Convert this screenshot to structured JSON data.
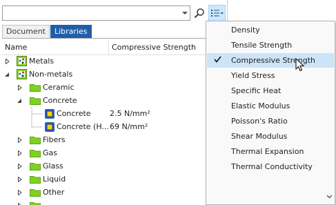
{
  "search": {
    "value": "",
    "placeholder": ""
  },
  "tabs": [
    {
      "label": "Document",
      "active": false
    },
    {
      "label": "Libraries",
      "active": true
    }
  ],
  "columns": {
    "name": "Name",
    "strength": "Compressive Strength"
  },
  "tree": {
    "metals": "Metals",
    "nonmetals": "Non-metals",
    "ceramic": "Ceramic",
    "concrete": "Concrete",
    "concrete_1": {
      "name": "Concrete",
      "value": "2.5 N/mm²"
    },
    "concrete_2": {
      "name": "Concrete (H...",
      "value": "69 N/mm²"
    },
    "fibers": "Fibers",
    "gas": "Gas",
    "glass": "Glass",
    "liquid": "Liquid",
    "other": "Other"
  },
  "menu": {
    "items": [
      {
        "label": "Density"
      },
      {
        "label": "Tensile Strength"
      },
      {
        "label": "Compressive Strength",
        "checked": true
      },
      {
        "label": "Yield Stress"
      },
      {
        "label": "Specific Heat"
      },
      {
        "label": "Elastic Modulus"
      },
      {
        "label": "Poisson's Ratio"
      },
      {
        "label": "Shear Modulus"
      },
      {
        "label": "Thermal Expansion"
      },
      {
        "label": "Thermal Conductivity"
      }
    ]
  },
  "colors": {
    "accent": "#1f5fa8",
    "folder": "#7ed321",
    "menu_hover": "#cce4f7",
    "material_icon": "#2c5fc4"
  }
}
